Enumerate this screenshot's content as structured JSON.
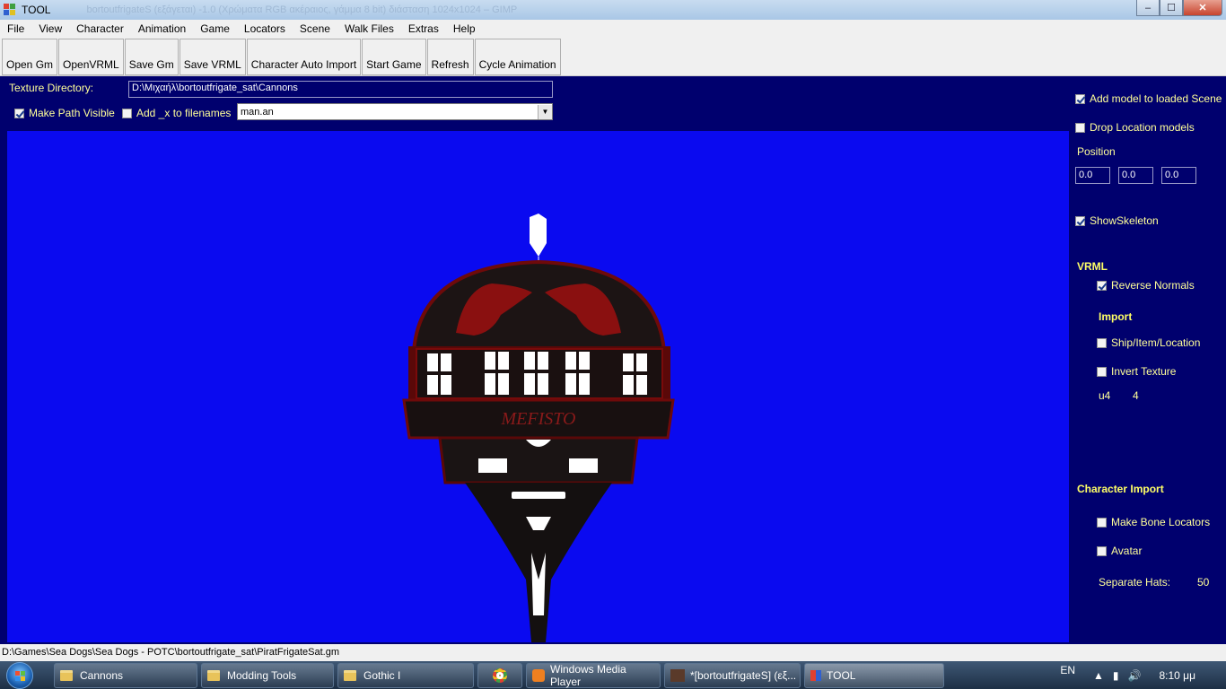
{
  "window": {
    "title": "TOOL",
    "background_title": "bortoutfrigateS (εξάγεται) -1.0 (Χρώματα RGB ακέραιος, γάμμα 8 bit) διάσταση 1024x1024 – GIMP",
    "buttons": [
      "minimize",
      "maximize",
      "close"
    ]
  },
  "menu": [
    "File",
    "View",
    "Character",
    "Animation",
    "Game",
    "Locators",
    "Scene",
    "Walk Files",
    "Extras",
    "Help"
  ],
  "toolbar": [
    "Open Gm",
    "OpenVRML",
    "Save Gm",
    "Save VRML",
    "Character Auto Import",
    "Start Game",
    "Refresh",
    "Cycle Animation"
  ],
  "form": {
    "texture_dir_label": "Texture Directory:",
    "texture_dir_value": "D:\\Μιχαήλ\\bortoutfrigate_sat\\Cannons",
    "make_path_visible": {
      "label": "Make Path Visible",
      "checked": true
    },
    "add_x": {
      "label": "Add _x to filenames",
      "checked": false
    },
    "animation_file": "man.an"
  },
  "right_panel": {
    "add_model": {
      "label": "Add model to loaded Scene",
      "checked": true
    },
    "drop_location": {
      "label": "Drop Location models",
      "checked": false
    },
    "position_label": "Position",
    "position": [
      "0.0",
      "0.0",
      "0.0"
    ],
    "show_skeleton": {
      "label": "ShowSkeleton",
      "checked": true
    },
    "vrml_title": "VRML",
    "reverse_normals": {
      "label": "Reverse Normals",
      "checked": true
    },
    "import_title": "Import",
    "ship_item_location": {
      "label": "Ship/Item/Location",
      "checked": false
    },
    "invert_texture": {
      "label": "Invert Texture",
      "checked": false
    },
    "u4_label": "u4",
    "u4_value": "4",
    "character_import_title": "Character Import",
    "make_bone_locators": {
      "label": "Make Bone Locators",
      "checked": false
    },
    "avatar": {
      "label": "Avatar",
      "checked": false
    },
    "separate_hats_label": "Separate Hats:",
    "separate_hats_value": "50"
  },
  "viewport": {
    "ship_name": "MEFISTO",
    "colors": {
      "background": "#0a0af0",
      "hull": "#1a1a1a",
      "trim": "#6e0a0a"
    }
  },
  "status_bar": "D:\\Games\\Sea Dogs\\Sea Dogs - POTC\\bortoutfrigate_sat\\PiratFrigateSat.gm",
  "taskbar": {
    "items": [
      {
        "label": "Cannons",
        "icon": "folder-icon"
      },
      {
        "label": "Modding Tools",
        "icon": "folder-icon"
      },
      {
        "label": "Gothic I",
        "icon": "folder-icon"
      },
      {
        "label": "",
        "icon": "chrome-icon"
      },
      {
        "label": "Windows Media Player",
        "icon": "media-player-icon"
      },
      {
        "label": "*[bortoutfrigateS] (εξ...",
        "icon": "gimp-icon"
      },
      {
        "label": "TOOL",
        "icon": "app-icon"
      }
    ],
    "language": "EN",
    "clock": "8:10 μμ"
  }
}
